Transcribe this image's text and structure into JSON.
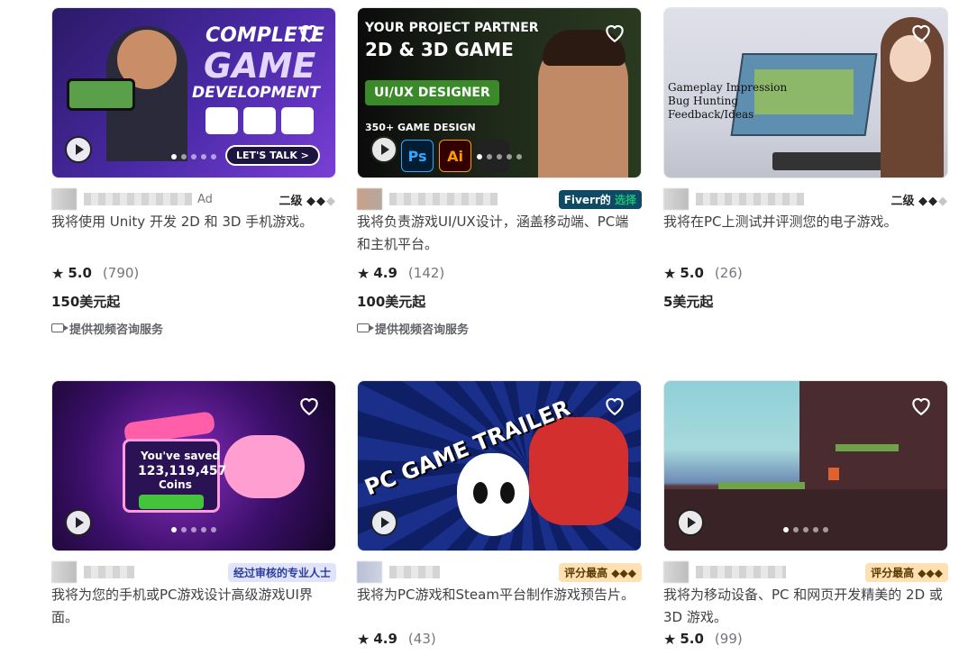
{
  "colors": {
    "accent_green": "#1dbf73",
    "fiverr_badge_bg": "#0e4a63",
    "pro_badge_bg": "#dfe4fb",
    "top_badge_bg": "#ffe0b2",
    "text_muted": "#74767e"
  },
  "cards": [
    {
      "thumb_text": {
        "line1": "COMPLETE",
        "line2": "GAME",
        "line3": "DEVELOPMENT",
        "cta": "LET'S TALK >"
      },
      "ad_label": "Ad",
      "level": "二级",
      "title": "我将使用 Unity 开发 2D 和 3D 手机游戏。",
      "rating": "5.0",
      "reviews": "(790)",
      "price": "150美元起",
      "consult": "提供视频咨询服务"
    },
    {
      "thumb_text": {
        "line1": "YOUR PROJECT PARTNER",
        "line2": "2D & 3D GAME",
        "line3": "UI/UX DESIGNER",
        "line4": "350+ GAME DESIGN"
      },
      "badge_main": "Fiverr的",
      "badge_accent": "选择",
      "title": "我将负责游戏UI/UX设计，涵盖移动端、PC端和主机平台。",
      "rating": "4.9",
      "reviews": "(142)",
      "price": "100美元起",
      "consult": "提供视频咨询服务"
    },
    {
      "thumb_text": {
        "line1": "Gameplay Impression",
        "line2": "Bug Hunting",
        "line3": "Feedback/Ideas"
      },
      "level": "二级",
      "title": "我将在PC上测试并评测您的电子游戏。",
      "rating": "5.0",
      "reviews": "(26)",
      "price": "5美元起"
    },
    {
      "thumb_text": {
        "line1": "You've saved",
        "line2": "123,119,457",
        "line3": "Coins"
      },
      "badge": "经过审核的专业人士",
      "title": "我将为您的手机或PC游戏设计高级游戏UI界面。"
    },
    {
      "thumb_text": {
        "line1": "PC GAME TRAILER"
      },
      "badge": "评分最高 ◆◆◆",
      "title": "我将为PC游戏和Steam平台制作游戏预告片。",
      "rating": "4.9",
      "reviews": "(43)"
    },
    {
      "badge": "评分最高 ◆◆◆",
      "title": "我将为移动设备、PC 和网页开发精美的 2D 或 3D 游戏。",
      "rating": "5.0",
      "reviews": "(99)"
    }
  ]
}
